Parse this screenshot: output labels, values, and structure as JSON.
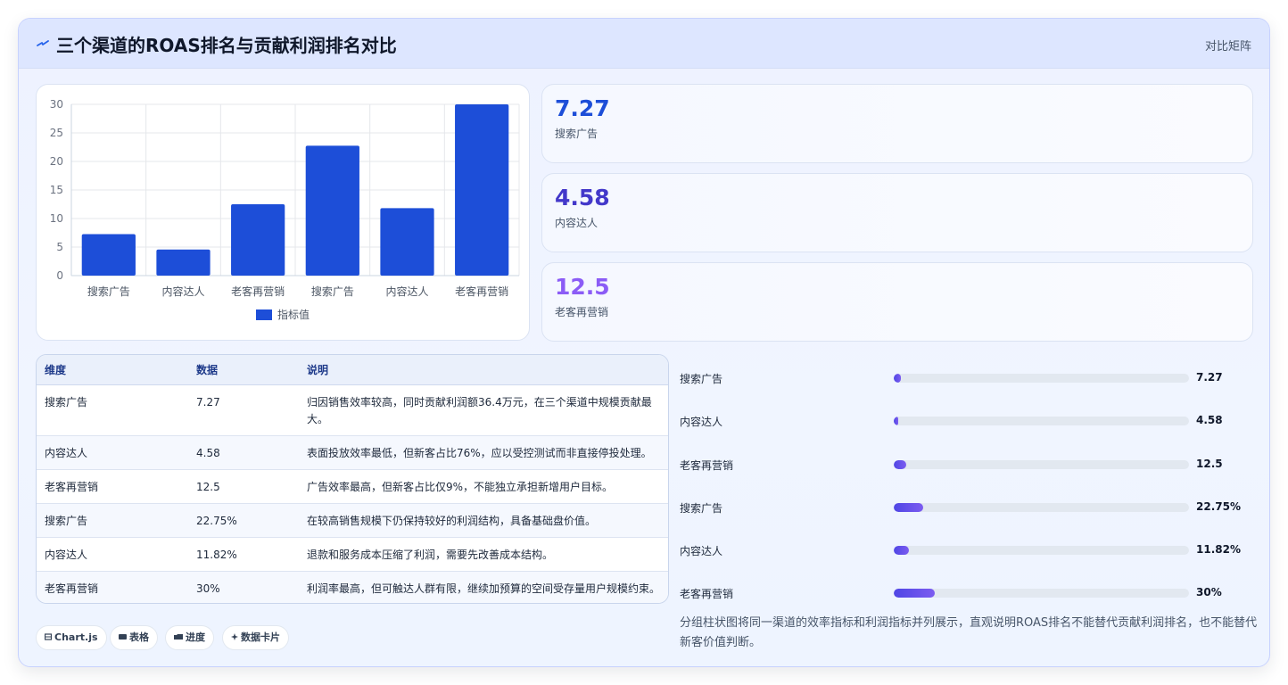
{
  "header": {
    "icon": "lightning-icon",
    "title": "三个渠道的ROAS排名与贡献利润排名对比",
    "right_label": "对比矩阵"
  },
  "chart_data": {
    "type": "bar",
    "categories": [
      "搜索广告",
      "内容达人",
      "老客再营销",
      "搜索广告",
      "内容达人",
      "老客再营销"
    ],
    "series": [
      {
        "name": "指标值",
        "values": [
          7.27,
          4.58,
          12.5,
          22.75,
          11.82,
          30
        ],
        "color": "#1d4ed8"
      }
    ],
    "title": "",
    "xlabel": "",
    "ylabel": "",
    "ylim": [
      0,
      30
    ],
    "yticks": [
      "0",
      "5",
      "10",
      "15",
      "20",
      "25",
      "30"
    ],
    "grid": true,
    "legend": "bottom"
  },
  "stats": [
    {
      "value": "7.27",
      "label": "搜索广告",
      "color": "#1d4ed8"
    },
    {
      "value": "4.58",
      "label": "内容达人",
      "color": "#4338ca"
    },
    {
      "value": "12.5",
      "label": "老客再营销",
      "color": "#8b5cf6"
    }
  ],
  "table": {
    "headers": [
      "维度",
      "数据",
      "说明"
    ],
    "rows": [
      {
        "dim": "搜索广告",
        "data": "7.27",
        "note": "归因销售效率较高，同时贡献利润额36.4万元，在三个渠道中规模贡献最大。"
      },
      {
        "dim": "内容达人",
        "data": "4.58",
        "note": "表面投放效率最低，但新客占比76%，应以受控测试而非直接停投处理。"
      },
      {
        "dim": "老客再营销",
        "data": "12.5",
        "note": "广告效率最高，但新客占比仅9%，不能独立承担新增用户目标。"
      },
      {
        "dim": "搜索广告",
        "data": "22.75%",
        "note": "在较高销售规模下仍保持较好的利润结构，具备基础盘价值。"
      },
      {
        "dim": "内容达人",
        "data": "11.82%",
        "note": "退款和服务成本压缩了利润，需要先改善成本结构。"
      },
      {
        "dim": "老客再营销",
        "data": "30%",
        "note": "利润率最高，但可触达人群有限，继续加预算的空间受存量用户规模约束。"
      }
    ]
  },
  "progress": [
    {
      "label": "搜索广告",
      "value": "7.27",
      "fraction": 0.0242
    },
    {
      "label": "内容达人",
      "value": "4.58",
      "fraction": 0.0153
    },
    {
      "label": "老客再营销",
      "value": "12.5",
      "fraction": 0.0417
    },
    {
      "label": "搜索广告",
      "value": "22.75%",
      "fraction": 0.1
    },
    {
      "label": "内容达人",
      "value": "11.82%",
      "fraction": 0.05
    },
    {
      "label": "老客再营销",
      "value": "30%",
      "fraction": 0.14
    }
  ],
  "tags": [
    {
      "icon": "chart-icon",
      "label": "Chart.js"
    },
    {
      "icon": "table-icon",
      "label": "表格"
    },
    {
      "icon": "progress-icon",
      "label": "进度"
    },
    {
      "icon": "sparkle-icon",
      "label": "数据卡片"
    }
  ],
  "footnote": "分组柱状图将同一渠道的效率指标和利润指标并列展示，直观说明ROAS排名不能替代贡献利润排名，也不能替代新客价值判断。"
}
